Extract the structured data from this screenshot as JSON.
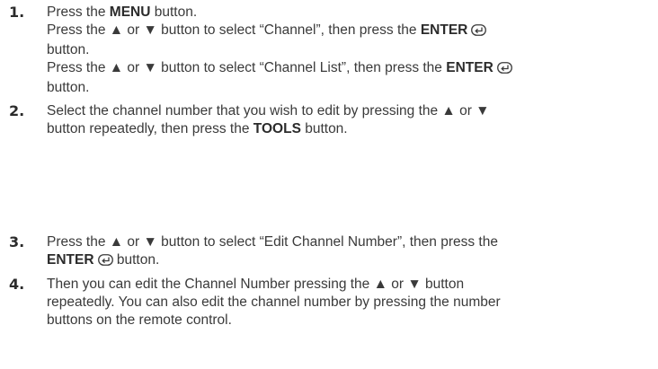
{
  "steps": [
    {
      "number": "1.",
      "lines": [
        [
          "Press the ",
          {
            "b": "MENU"
          },
          " button."
        ],
        [
          "Press the ▲ or ▼ button to select “Channel”, then press the ",
          {
            "b": "ENTER"
          },
          {
            "icon": "enter-icon"
          }
        ],
        [
          "button."
        ],
        [
          "Press the ▲ or ▼ button to select “Channel List”, then press the ",
          {
            "b": "ENTER"
          },
          {
            "icon": "enter-icon"
          }
        ],
        [
          "button."
        ]
      ]
    },
    {
      "number": "2.",
      "lines": [
        [
          "Select the channel number that you wish to edit by pressing the ▲ or ▼"
        ],
        [
          "button repeatedly, then press the ",
          {
            "b": "TOOLS"
          },
          " button."
        ]
      ]
    },
    {
      "number": "3.",
      "lines": [
        [
          "Press the ▲ or ▼ button to select “Edit Channel Number”, then press the"
        ],
        [
          {
            "b": "ENTER"
          },
          {
            "icon": "enter-icon"
          },
          " button."
        ]
      ]
    },
    {
      "number": "4.",
      "lines": [
        [
          "Then you can edit the Channel Number pressing the ▲ or ▼ button"
        ],
        [
          "repeatedly. You can also edit the channel number by pressing the number"
        ],
        [
          "buttons on the remote control."
        ]
      ]
    }
  ]
}
